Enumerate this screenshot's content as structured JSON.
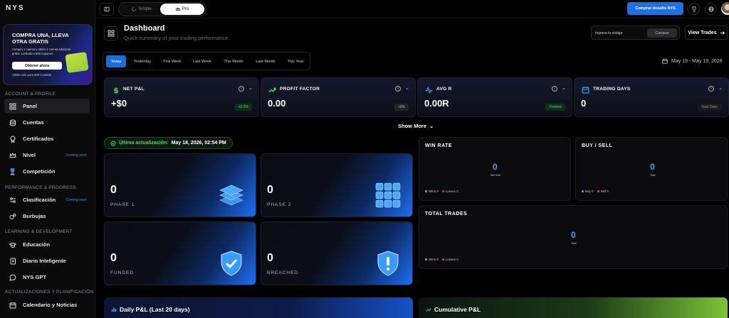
{
  "app": {
    "logo": "NYS"
  },
  "promo": {
    "title": "COMPRA UNA, LLEVA OTRA GRATIS",
    "subtitle": "Compra 1 cuenta y obtén 1 cuenta adicional gratis. Limitado a 500 cupones.",
    "button": "Obtener ahora",
    "footer": "Válido solo para 500 Cuentas"
  },
  "sidebar": {
    "sections": [
      {
        "label": "ACCOUNT & PROFILE"
      },
      {
        "label": "PERFORMANCE & PROGRESS"
      },
      {
        "label": "LEARNING & DEVELOPMENT"
      },
      {
        "label": "ACTUALIZACIONES Y PLANIFICACIÓN"
      }
    ],
    "items": [
      {
        "label": "Panel",
        "icon": "grid-icon",
        "active": true
      },
      {
        "label": "Cuentas",
        "icon": "database-icon"
      },
      {
        "label": "Certificados",
        "icon": "certificate-icon"
      },
      {
        "label": "Nivel",
        "icon": "crown-icon",
        "badge": "Coming soon"
      },
      {
        "label": "Competición",
        "icon": "trophy-icon"
      },
      {
        "label": "Clasificación",
        "icon": "sliders-icon",
        "badge": "Coming soon"
      },
      {
        "label": "Burbujas",
        "icon": "bubbles-icon"
      },
      {
        "label": "Educación",
        "icon": "graduation-icon"
      },
      {
        "label": "Diario Inteligente",
        "icon": "journal-icon"
      },
      {
        "label": "NYS GPT",
        "icon": "chat-icon"
      },
      {
        "label": "Calendario y Noticias",
        "icon": "calendar-icon"
      }
    ]
  },
  "topbar": {
    "mode_simple": "Simple",
    "mode_pro": "Pro",
    "buy_button": "Comprar desafío NYS"
  },
  "header": {
    "title": "Dashboard",
    "subtitle": "Quick summary of your trading performance.",
    "code_placeholder": "Ingresa tu código",
    "redeem": "Canjear",
    "view_trades": "View Trades"
  },
  "ranges": [
    "Today",
    "Yesterday",
    "This Week",
    "Last Week",
    "This Month",
    "Last Month",
    "This Year"
  ],
  "date_range": "May 19 - May 19, 2026",
  "kpis": [
    {
      "title": "NET P&L",
      "value": "+$0",
      "badge": "+0.0%",
      "badge_color": "#3ddc66"
    },
    {
      "title": "PROFIT FACTOR",
      "value": "0.00",
      "badge": "+0%",
      "badge_color": "#b0b0b5"
    },
    {
      "title": "AVG R",
      "value": "0.00R",
      "badge": "Positive",
      "badge_color": "#3ddc66"
    },
    {
      "title": "TRADING DAYS",
      "value": "0",
      "badge": "Start Date:",
      "badge_color": "#9a9aa0"
    }
  ],
  "show_more": "Show More",
  "last_update": {
    "label": "Última actualización:",
    "value": "May 18, 2026, 02:54 PM"
  },
  "phases": [
    {
      "value": "0",
      "label": "PHASE 1",
      "icon": "stack-icon"
    },
    {
      "value": "0",
      "label": "PHASE 2",
      "icon": "grid-blocks-icon"
    },
    {
      "value": "0",
      "label": "FUNDED",
      "icon": "shield-check-icon"
    },
    {
      "value": "0",
      "label": "BREACHED",
      "icon": "shield-alert-icon"
    }
  ],
  "win_rate": {
    "title": "WIN RATE",
    "value": "0",
    "sub": "Win Rate",
    "legend_a": "Wins 0",
    "legend_b": "Losses 0"
  },
  "buy_sell": {
    "title": "BUY / SELL",
    "value": "0",
    "sub": "Total",
    "legend_a": "Buy 0",
    "legend_b": "Sell 0"
  },
  "total_trades": {
    "title": "TOTAL TRADES",
    "value": "0",
    "sub": "Total",
    "legend_a": "Wins 0",
    "legend_b": "Losses 0"
  },
  "bottom": {
    "daily": "Daily P&L (Last 20 days)",
    "cumulative": "Cumulative P&L"
  },
  "colors": {
    "accent": "#1f6fe6",
    "success": "#3ddc66",
    "loss": "#e0444b",
    "value": "#3fa6ff"
  }
}
